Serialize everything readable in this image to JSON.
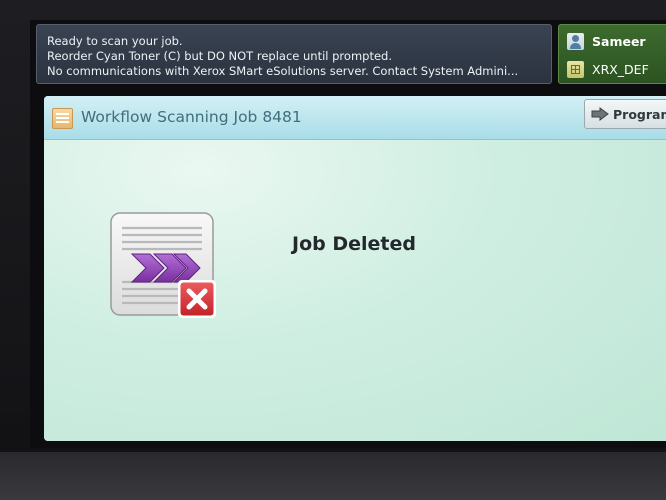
{
  "status": {
    "lines": [
      "Ready to scan your job.",
      "Reorder Cyan Toner (C) but DO NOT replace until prompted.",
      "No communications with Xerox SMart eSolutions server. Contact System Admini..."
    ]
  },
  "user_panel": {
    "user_name": "Sameer",
    "domain": "XRX_DEF",
    "user_icon": "person-icon",
    "domain_icon": "network-domain-icon"
  },
  "window": {
    "title": "Workflow Scanning Job 8481",
    "title_icon": "workflow-scan-icon",
    "program_button": {
      "label": "Program",
      "icon": "arrow-right-icon"
    }
  },
  "main": {
    "message": "Job Deleted",
    "job_icon": "document-deleted-icon"
  },
  "colors": {
    "content_bg": "#c9ecde",
    "title_bar": "#a9dde7",
    "title_text": "#3f6e7d",
    "user_panel": "#2c5321",
    "status_box": "#2b3340",
    "delete_badge": "#d9363b",
    "chevron": "#8a3fb0"
  }
}
